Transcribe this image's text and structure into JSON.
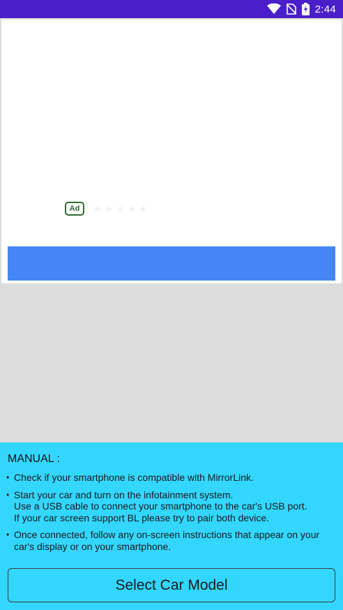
{
  "status_bar": {
    "time": "2:44",
    "icons": [
      "wifi-icon",
      "no-sim-icon",
      "battery-charging-icon"
    ],
    "background": "#4a1fc9"
  },
  "ad": {
    "badge": "Ad",
    "rating_stars": 5,
    "button_color": "#4686f4"
  },
  "manual": {
    "title": "MANUAL :",
    "items": [
      "Check if your smartphone is compatible with MirrorLink.",
      "Start your car and turn on the infotainment system.\nUse a USB cable to connect your smartphone to the car's USB port.\nIf your car screen support BL please try to pair both device.",
      "Once connected, follow any on-screen instructions that appear on your car's display or on your smartphone."
    ],
    "background": "#33d6ff"
  },
  "select_button": {
    "label": "Select Car Model"
  }
}
